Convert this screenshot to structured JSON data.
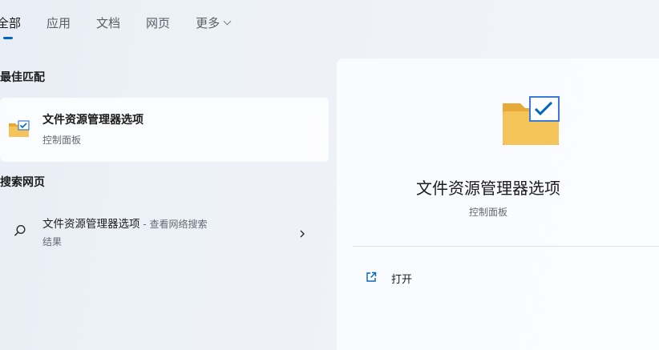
{
  "tabs": [
    {
      "label": "全部",
      "active": true
    },
    {
      "label": "应用",
      "active": false
    },
    {
      "label": "文档",
      "active": false
    },
    {
      "label": "网页",
      "active": false
    },
    {
      "label": "更多",
      "active": false
    }
  ],
  "best_match": {
    "heading": "最佳匹配",
    "title": "文件资源管理器选项",
    "subtitle": "控制面板",
    "icon": "folder-check-icon"
  },
  "web_search": {
    "heading": "搜索网页",
    "query": "文件资源管理器选项",
    "suffix": " - 查看网络搜索",
    "line2": "结果",
    "icon": "search-icon"
  },
  "detail": {
    "title": "文件资源管理器选项",
    "subtitle": "控制面板",
    "actions": [
      {
        "label": "打开",
        "icon": "open-external-icon"
      }
    ]
  },
  "colors": {
    "accent": "#0067c0",
    "folder": "#f4c35a",
    "folder_dark": "#e6a93a"
  }
}
